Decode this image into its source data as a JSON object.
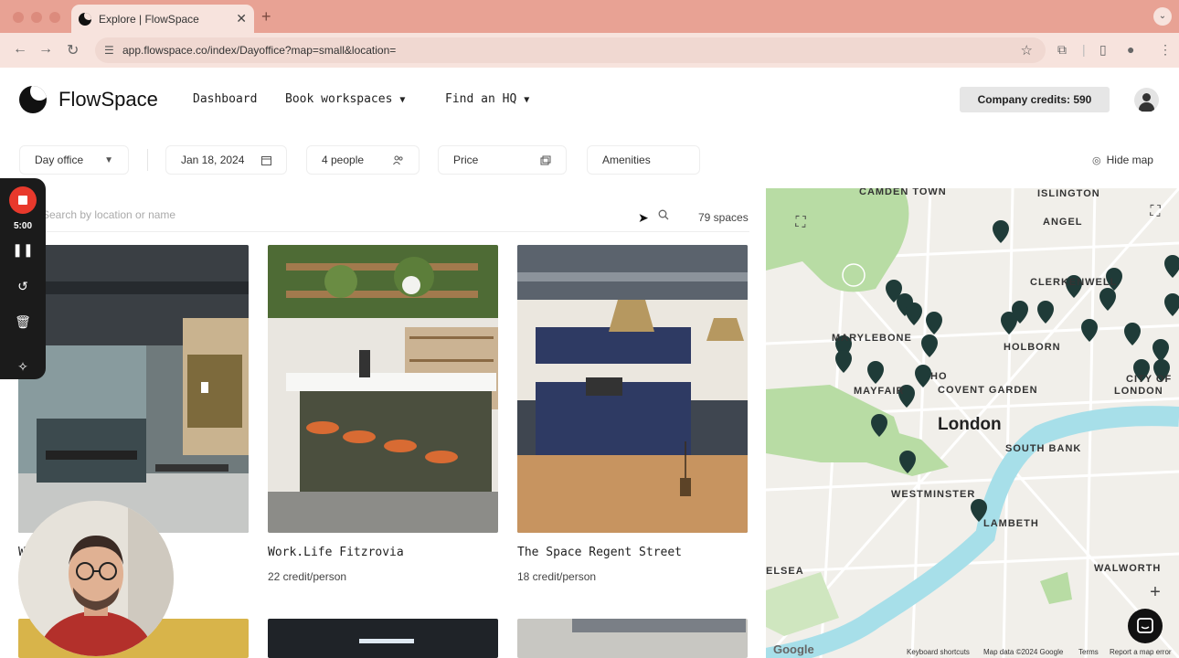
{
  "browser": {
    "tab_title": "Explore | FlowSpace",
    "url": "app.flowspace.co/index/Dayoffice?map=small&location="
  },
  "header": {
    "brand": "FlowSpace",
    "nav": [
      {
        "label": "Dashboard",
        "dropdown": false
      },
      {
        "label": "Book workspaces",
        "dropdown": true
      },
      {
        "label": "Find an HQ",
        "dropdown": true
      }
    ],
    "credits_label": "Company credits: 590"
  },
  "filters": {
    "type": "Day office",
    "date": "Jan 18, 2024",
    "people": "4 people",
    "price": "Price",
    "amenities": "Amenities",
    "hide_map": "Hide map"
  },
  "search": {
    "placeholder": "Search by location or name",
    "count": "79 spaces"
  },
  "recorder": {
    "time": "5:00"
  },
  "cards": [
    {
      "title": "W",
      "subtitle": ""
    },
    {
      "title": "Work.Life Fitzrovia",
      "subtitle": "22 credit/person"
    },
    {
      "title": "The Space Regent Street",
      "subtitle": "18 credit/person"
    }
  ],
  "map": {
    "city": "London",
    "labels": [
      "CAMDEN TOWN",
      "ISLINGTON",
      "ANGEL",
      "CLERKENWELL",
      "MARYLEBONE",
      "HOLBORN",
      "HO",
      "CITY OF",
      "LONDON",
      "MAYFAIR",
      "COVENT GARDEN",
      "SOUTH BANK",
      "WESTMINSTER",
      "LAMBETH",
      "ELSEA",
      "WALWORTH"
    ],
    "attribution": {
      "brand": "Google",
      "shortcuts": "Keyboard shortcuts",
      "data": "Map data ©2024 Google",
      "terms": "Terms",
      "report": "Report a map error"
    }
  },
  "colors": {
    "browser_tabstrip": "#e8a294",
    "browser_toolbar": "#f7e3dd",
    "recorder_stop": "#e8392c",
    "map_river": "#a7dfe9",
    "map_park": "#b8dca4",
    "pin": "#1f3b38"
  }
}
